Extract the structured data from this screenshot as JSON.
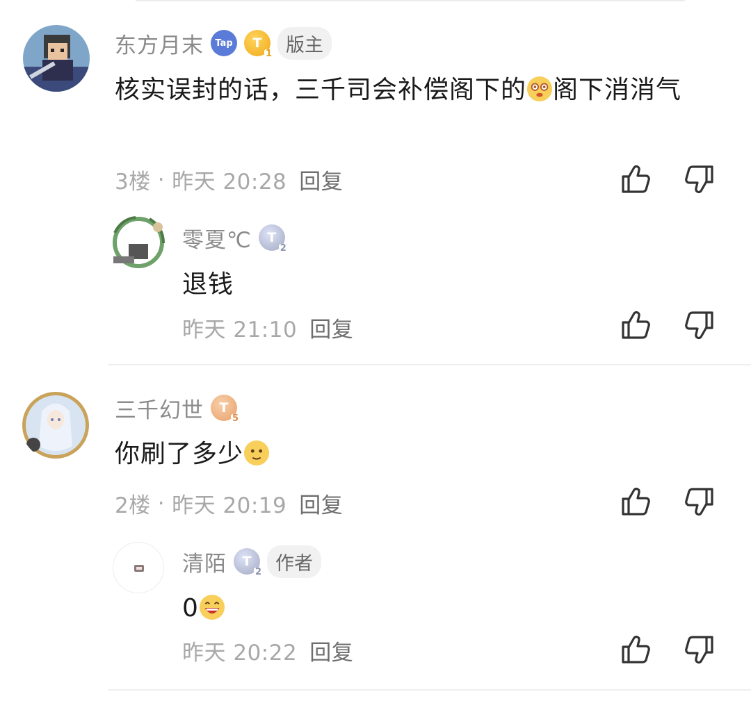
{
  "comments": [
    {
      "username": "东方月末",
      "badges": [
        "Tap",
        "T",
        "版主"
      ],
      "badge_level": "1",
      "text": "核实误封的话，三千司会补偿阁下的",
      "text_after_emoji": "阁下消消气",
      "floor": "3楼",
      "time": "昨天 20:28",
      "reply_label": "回复",
      "replies": [
        {
          "username": "零夏℃",
          "badge_level": "2",
          "text": "退钱",
          "time": "昨天 21:10",
          "reply_label": "回复"
        }
      ]
    },
    {
      "username": "三千幻世",
      "badge_level": "5",
      "text": "你刷了多少",
      "floor": "2楼",
      "time": "昨天 20:19",
      "reply_label": "回复",
      "replies": [
        {
          "username": "清陌",
          "badge_level": "2",
          "tag": "作者",
          "text": "0",
          "time": "昨天 20:22",
          "reply_label": "回复"
        }
      ]
    }
  ],
  "separator": "·",
  "badge_letter": "T",
  "icons": [
    "like-icon",
    "dislike-icon"
  ],
  "colors": {
    "gold_badge": "#f0a81a",
    "silver_badge": "#a2a9c2",
    "bronze_badge": "#e8a06a",
    "tap_badge": "#5a7bd8"
  }
}
